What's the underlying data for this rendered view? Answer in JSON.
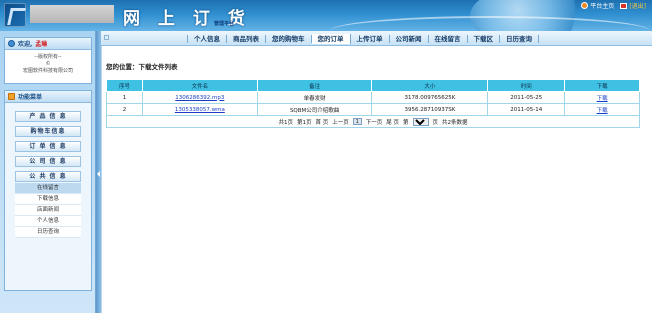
{
  "header": {
    "title": "网 上 订 货",
    "subtitle": "管理平台",
    "links": {
      "home": "平台主页",
      "exit": "[退出]"
    }
  },
  "sidebar": {
    "welcome": {
      "label": "欢迎,",
      "username": "孟琳",
      "line1": "--版权所有--",
      "line2": "©",
      "line3": "宏图软件科技有限公司"
    },
    "menu": {
      "title": "功能菜单",
      "buttons": [
        "产 品 信 息",
        "购物车信息",
        "订 单 信 息",
        "公 司 信 息",
        "公 共 信 息"
      ],
      "submenu": [
        "在线留言",
        "下载信息",
        "店面新闻",
        "个人信息",
        "日历查询"
      ]
    }
  },
  "nav": {
    "items": [
      "个人信息",
      "商品列表",
      "您的购物车",
      "您的订单",
      "上传订单",
      "公司新闻",
      "在线留言",
      "下载区",
      "日历查询"
    ],
    "active_index": 3
  },
  "main": {
    "location": "您的位置：下载文件列表",
    "table": {
      "headers": [
        "序号",
        "文件名",
        "备注",
        "大小",
        "时间",
        "下载"
      ],
      "rows": [
        {
          "no": "1",
          "file": "1306286392.mp3",
          "note": "单春发财",
          "size": "3178.009765625K",
          "time": "2011-05-25",
          "download": "下载"
        },
        {
          "no": "2",
          "file": "1305338057.wma",
          "note": "SQBM公司介绍歌曲",
          "size": "3956.28710937SK",
          "time": "2011-05-14",
          "download": "下载"
        }
      ]
    },
    "pager": {
      "total_pages": "共1页",
      "current": "第1页",
      "first": "首 页",
      "prev": "上一页",
      "page_box": "1",
      "next": "下一页",
      "last": "尾 页",
      "goto": "第",
      "select_value": "1",
      "page_unit": "页",
      "total_records": "共2条数据"
    }
  },
  "colors": {
    "header_blue": "#2f8fd0",
    "table_header": "#3fc1e4",
    "link": "#1a3fc4",
    "username_red": "#d11b1b"
  }
}
